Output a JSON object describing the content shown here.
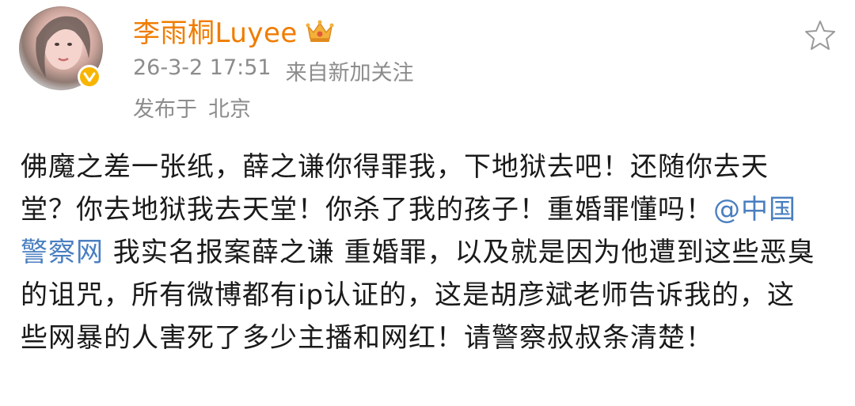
{
  "post": {
    "username": "李雨桐Luyee",
    "timestamp": "26-3-2 17:51",
    "source": "来自新加关注",
    "location_prefix": "发布于",
    "location": "北京",
    "body_part1": "佛魔之差一张纸，薛之谦你得罪我，下地狱去吧！还随你去天堂？你去地狱我去天堂！你杀了我的孩子！重婚罪懂吗！",
    "mention": "@中国警察网",
    "body_part2": " 我实名报案薛之谦 重婚罪，以及就是因为他遭到这些恶臭的诅咒，所有微博都有ip认证的，这是胡彦斌老师告诉我的，这些网暴的人害死了多少主播和网红！请警察叔叔条清楚！"
  },
  "icons": {
    "avatar": "avatar-photo",
    "verify": "verified-badge-icon",
    "crown": "crown-icon",
    "favorite": "star-icon"
  },
  "colors": {
    "username": "#f07c00",
    "meta": "#8c8c8c",
    "mention": "#4a7fc0",
    "badge": "#f7b500"
  }
}
